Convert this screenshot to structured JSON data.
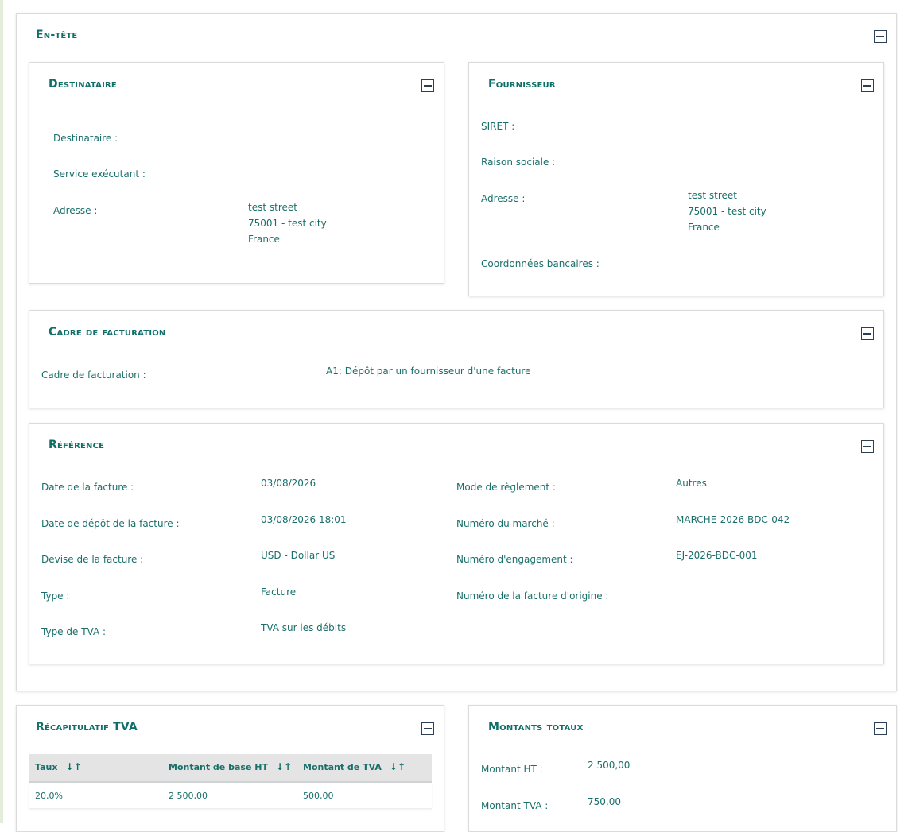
{
  "header": {
    "title": "En-tête"
  },
  "destinataire": {
    "title": "Destinataire",
    "labels": {
      "destinataire": "Destinataire :",
      "service": "Service exécutant :",
      "adresse": "Adresse  :"
    },
    "address": {
      "street": "test street",
      "city": "75001 - test city",
      "country": "France"
    }
  },
  "fournisseur": {
    "title": "Fournisseur",
    "labels": {
      "siret": "SIRET :",
      "raison": "Raison sociale :",
      "adresse": "Adresse  :",
      "coordonnees": "Coordonnées bancaires :"
    },
    "address": {
      "street": "test street",
      "city": "75001 - test city",
      "country": "France"
    }
  },
  "cadre": {
    "title": "Cadre de facturation",
    "label": "Cadre de facturation :",
    "value": "A1: Dépôt par un fournisseur d'une facture"
  },
  "reference": {
    "title": "Référence",
    "left": [
      {
        "label": "Date de la facture :",
        "value": "03/08/2026"
      },
      {
        "label": "Date de dépôt de la facture :",
        "value": "03/08/2026 18:01"
      },
      {
        "label": "Devise de la facture :",
        "value": "USD - Dollar US"
      },
      {
        "label": "Type :",
        "value": "Facture"
      },
      {
        "label": "Type de TVA :",
        "value": "TVA sur les débits"
      }
    ],
    "right": [
      {
        "label": "Mode de règlement :",
        "value": "Autres"
      },
      {
        "label": "Numéro du marché :",
        "value": "MARCHE-2026-BDC-042"
      },
      {
        "label": "Numéro d'engagement :",
        "value": "EJ-2026-BDC-001"
      },
      {
        "label": "Numéro de la facture d'origine :",
        "value": ""
      }
    ]
  },
  "tva_recap": {
    "title": "Récapitulatif TVA",
    "columns": [
      "Taux",
      "Montant de base HT",
      "Montant de TVA"
    ],
    "sort_icon": "sort-arrows-icon",
    "rows": [
      [
        "20,0%",
        "2 500,00",
        "500,00"
      ]
    ]
  },
  "totaux": {
    "title": "Montants totaux",
    "rows": [
      {
        "label": "Montant HT :",
        "value": "2 500,00"
      },
      {
        "label": "Montant TVA :",
        "value": "750,00"
      }
    ]
  },
  "icons": {
    "collapse": "collapse-minus-icon"
  },
  "colors": {
    "accent": "#0f6e68",
    "text": "#1a6f6a",
    "icon": "#2d3f55",
    "table_header": "#e4e4e4"
  }
}
